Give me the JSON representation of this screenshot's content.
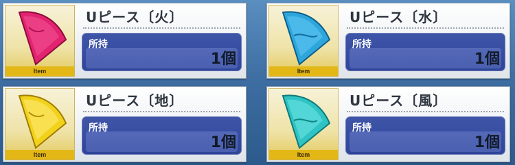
{
  "cards": [
    {
      "name": "Uピース〔火〕",
      "owned_label": "所持",
      "count": "1個",
      "tag": "Item",
      "color": "#e2236f"
    },
    {
      "name": "Uピース〔水〕",
      "owned_label": "所持",
      "count": "1個",
      "tag": "Item",
      "color": "#2ea6dc"
    },
    {
      "name": "Uピース〔地〕",
      "owned_label": "所持",
      "count": "1個",
      "tag": "Item",
      "color": "#f2d21a"
    },
    {
      "name": "Uピース〔風〕",
      "owned_label": "所持",
      "count": "1個",
      "tag": "Item",
      "color": "#2fc3c3"
    }
  ]
}
